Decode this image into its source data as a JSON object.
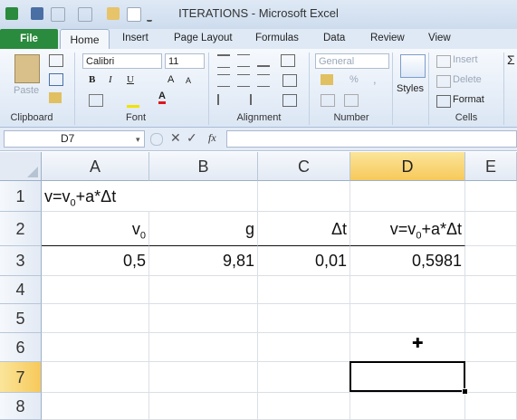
{
  "window": {
    "title": "ITERATIONS  -  Microsoft Excel"
  },
  "tabs": [
    "File",
    "Home",
    "Insert",
    "Page Layout",
    "Formulas",
    "Data",
    "Review",
    "View"
  ],
  "ribbon": {
    "clipboard": {
      "paste": "Paste",
      "label": "Clipboard"
    },
    "font": {
      "name": "Calibri",
      "size": "11",
      "label": "Font"
    },
    "alignment": {
      "label": "Alignment"
    },
    "number": {
      "format": "General",
      "percent": "%",
      "comma": ",",
      "label": "Number"
    },
    "styles": {
      "label": "Styles"
    },
    "cells": {
      "insert": "Insert",
      "delete": "Delete",
      "format": "Format",
      "label": "Cells"
    },
    "editing": {
      "sigma": "Σ"
    }
  },
  "formula_bar": {
    "name_box": "D7",
    "fx": "fx",
    "content": ""
  },
  "grid": {
    "columns": [
      "A",
      "B",
      "C",
      "D",
      "E"
    ],
    "selected_column": "D",
    "rows": [
      "1",
      "2",
      "3",
      "4",
      "5",
      "6",
      "7",
      "8"
    ],
    "selected_row": "7",
    "cells": {
      "A1_pre": "v=v",
      "A1_sub": "0",
      "A1_post": "+a*Δt",
      "A2_pre": "v",
      "A2_sub": "0",
      "B2": "g",
      "C2": "Δt",
      "D2_pre": "v=v",
      "D2_sub": "0",
      "D2_post": "+a*Δt",
      "A3": "0,5",
      "B3": "9,81",
      "C3": "0,01",
      "D3": "0,5981"
    },
    "active_cell": "D7"
  }
}
